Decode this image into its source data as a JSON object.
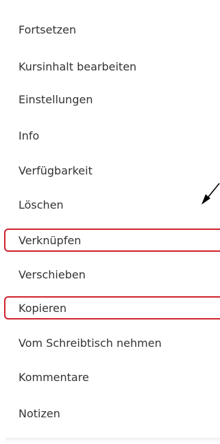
{
  "menu": {
    "items": [
      {
        "label": "Fortsetzen"
      },
      {
        "label": "Kursinhalt bearbeiten"
      },
      {
        "label": "Einstellungen"
      },
      {
        "label": "Info"
      },
      {
        "label": "Verfügbarkeit"
      },
      {
        "label": "Löschen"
      },
      {
        "label": "Verknüpfen",
        "highlighted": true
      },
      {
        "label": "Verschieben"
      },
      {
        "label": "Kopieren",
        "highlighted": true
      },
      {
        "label": "Vom Schreibtisch nehmen"
      },
      {
        "label": "Kommentare"
      },
      {
        "label": "Notizen"
      }
    ]
  },
  "colors": {
    "highlight_border": "#d0202a",
    "text": "#333333",
    "arrow": "#000000"
  },
  "annotations": {
    "arrow_icon": "arrow-pointing-down-left-icon"
  }
}
